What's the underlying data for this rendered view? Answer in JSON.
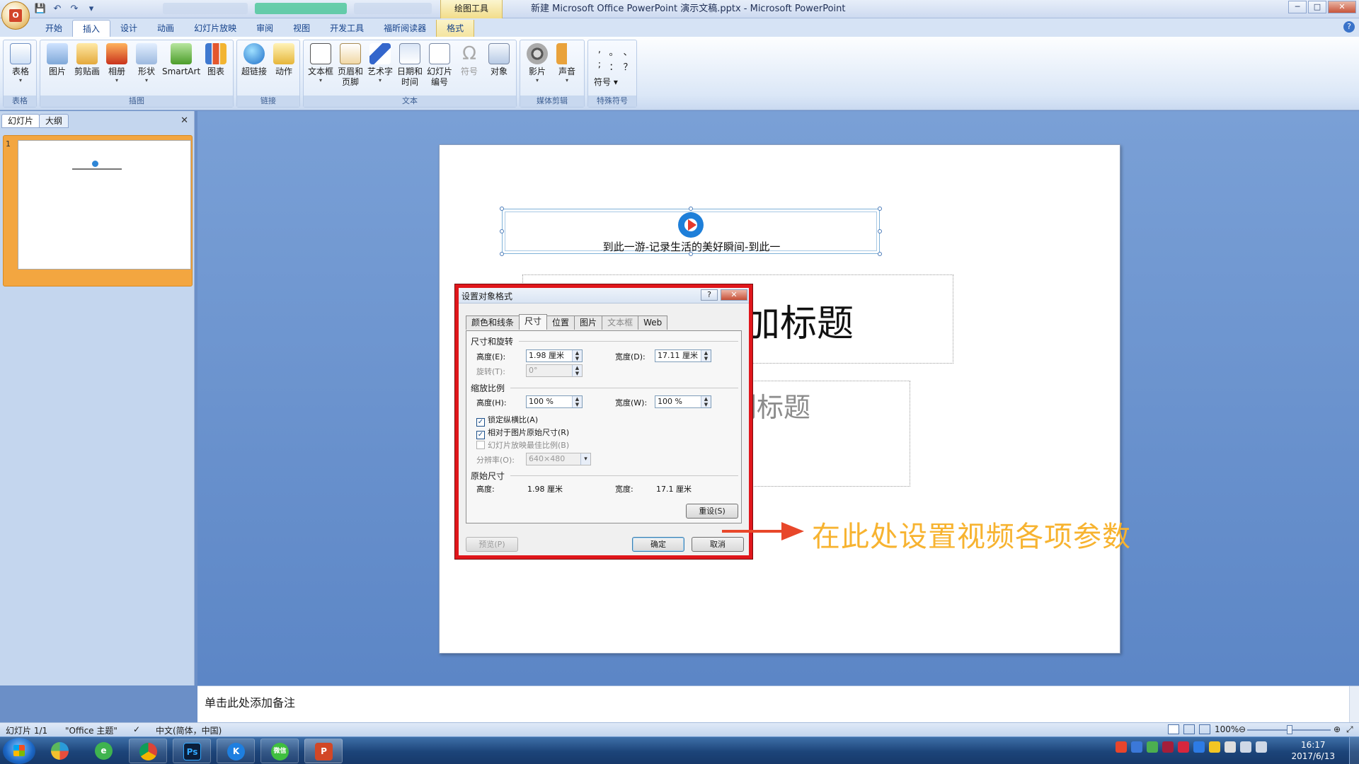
{
  "window": {
    "title": "新建 Microsoft Office PowerPoint 演示文稿.pptx - Microsoft PowerPoint",
    "context_tool": "绘图工具",
    "controls": [
      "─",
      "□",
      "✕"
    ]
  },
  "qat": [
    "💾",
    "↶",
    "↷",
    "▾"
  ],
  "tabs": [
    "开始",
    "插入",
    "设计",
    "动画",
    "幻灯片放映",
    "审阅",
    "视图",
    "开发工具",
    "福昕阅读器",
    "格式"
  ],
  "ribbon": {
    "groups": {
      "table": "表格",
      "illustrations": "插图",
      "links": "链接",
      "text": "文本",
      "media": "媒体剪辑",
      "symbols": "特殊符号"
    },
    "buttons": {
      "table": "表格",
      "picture": "图片",
      "clipart": "剪贴画",
      "album": "相册",
      "shapes": "形状",
      "smartart": "SmartArt",
      "chart": "图表",
      "hyperlink": "超链接",
      "action": "动作",
      "textbox": "文本框",
      "header_footer_1": "页眉和",
      "header_footer_2": "页脚",
      "wordart": "艺术字",
      "datetime_1": "日期和",
      "datetime_2": "时间",
      "slidenum_1": "幻灯片",
      "slidenum_2": "编号",
      "symbol": "符号",
      "object": "对象",
      "movie": "影片",
      "sound": "声音",
      "special_symbol": "符号"
    },
    "special_chars": [
      ",",
      "。",
      "、",
      ";",
      "：",
      "？"
    ]
  },
  "left_pane": {
    "tab_slides": "幻灯片",
    "tab_outline": "大纲",
    "close": "✕",
    "slide_number": "1"
  },
  "slide": {
    "video_caption": "到此一游-记录生活的美好瞬间-到此一",
    "title_placeholder": "处添加标题",
    "subtitle_placeholder": "处添加副标题"
  },
  "dialog": {
    "title": "设置对象格式",
    "help": "?",
    "close": "✕",
    "tabs": [
      "颜色和线条",
      "尺寸",
      "位置",
      "图片",
      "文本框",
      "Web"
    ],
    "section_size_rotate": "尺寸和旋转",
    "height_label": "高度(E):",
    "height_value": "1.98 厘米",
    "width_label": "宽度(D):",
    "width_value": "17.11 厘米",
    "rotate_label": "旋转(T):",
    "rotate_value": "0°",
    "section_scale": "缩放比例",
    "scale_height_label": "高度(H):",
    "scale_height_value": "100 %",
    "scale_width_label": "宽度(W):",
    "scale_width_value": "100 %",
    "cb_lock_ratio": "锁定纵横比(A)",
    "cb_relative_original": "相对于图片原始尺寸(R)",
    "cb_best_scale": "幻灯片放映最佳比例(B)",
    "resolution_label": "分辨率(O):",
    "resolution_value": "640×480",
    "section_original": "原始尺寸",
    "orig_height_label": "高度:",
    "orig_height_value": "1.98 厘米",
    "orig_width_label": "宽度:",
    "orig_width_value": "17.1 厘米",
    "reset": "重设(S)",
    "preview": "预览(P)",
    "ok": "确定",
    "cancel": "取消"
  },
  "annotation": "在此处设置视频各项参数",
  "notes_placeholder": "单击此处添加备注",
  "status": {
    "slide_count": "幻灯片 1/1",
    "theme": "\"Office 主题\"",
    "language": "中文(简体，中国)",
    "zoom": "100%"
  },
  "taskbar": {
    "apps": [
      "Chrome",
      "Ps",
      "K",
      "微信",
      "PowerPoint"
    ],
    "time": "16:17",
    "date": "2017/6/13"
  },
  "colors": {
    "dialog_highlight": "#e0161b",
    "annotation": "#f7b330",
    "arrow": "#e8472a"
  }
}
